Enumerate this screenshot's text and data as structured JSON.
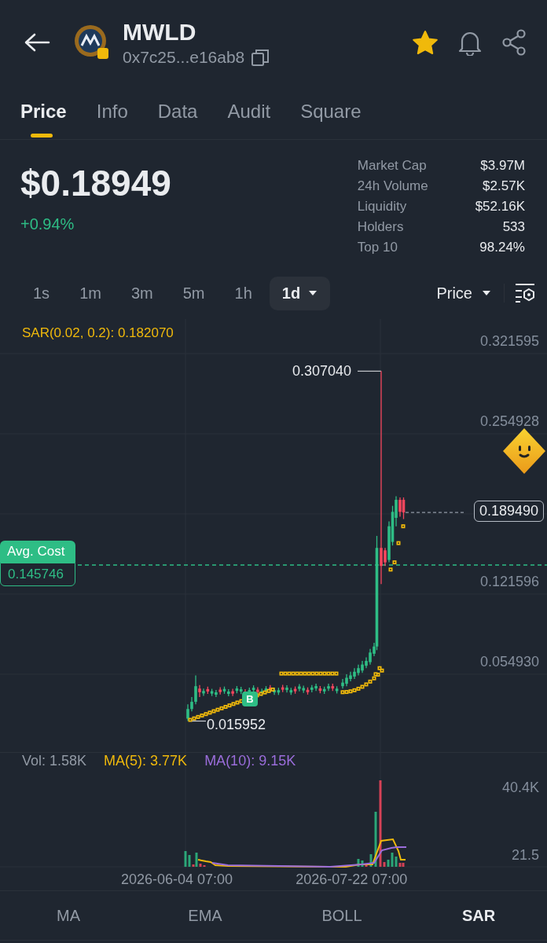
{
  "header": {
    "symbol": "MWLD",
    "address": "0x7c25...e16ab8",
    "favorite": true
  },
  "tabs": [
    {
      "label": "Price",
      "selected": true
    },
    {
      "label": "Info",
      "selected": false
    },
    {
      "label": "Data",
      "selected": false
    },
    {
      "label": "Audit",
      "selected": false
    },
    {
      "label": "Square",
      "selected": false
    }
  ],
  "price": {
    "value": "$0.18949",
    "change": "+0.94%"
  },
  "stats": [
    {
      "label": "Market Cap",
      "value": "$3.97M"
    },
    {
      "label": "24h Volume",
      "value": "$2.57K"
    },
    {
      "label": "Liquidity",
      "value": "$52.16K"
    },
    {
      "label": "Holders",
      "value": "533"
    },
    {
      "label": "Top 10",
      "value": "98.24%"
    }
  ],
  "intervals": [
    {
      "label": "1s",
      "selected": false
    },
    {
      "label": "1m",
      "selected": false
    },
    {
      "label": "3m",
      "selected": false
    },
    {
      "label": "5m",
      "selected": false
    },
    {
      "label": "1h",
      "selected": false
    },
    {
      "label": "1d",
      "selected": true
    }
  ],
  "chart_mode": "Price",
  "chart": {
    "indicator_label": "SAR(0.02, 0.2): 0.182070",
    "y_axis": [
      "0.321595",
      "0.254928",
      "0.121596",
      "0.054930"
    ],
    "high_label": "0.307040",
    "low_label": "0.015952",
    "last_price": "0.189490",
    "avg_cost": {
      "label": "Avg. Cost",
      "value": "0.145746"
    },
    "trade_marker": "B"
  },
  "volume": {
    "vol": "Vol: 1.58K",
    "ma5": "MA(5): 3.77K",
    "ma10": "MA(10): 9.15K",
    "y_axis": [
      "40.4K",
      "21.5"
    ]
  },
  "dates": [
    "2026-06-04 07:00",
    "2026-07-22 07:00"
  ],
  "indicators": [
    {
      "label": "MA",
      "selected": false
    },
    {
      "label": "EMA",
      "selected": false
    },
    {
      "label": "BOLL",
      "selected": false
    },
    {
      "label": "SAR",
      "selected": true
    }
  ]
}
